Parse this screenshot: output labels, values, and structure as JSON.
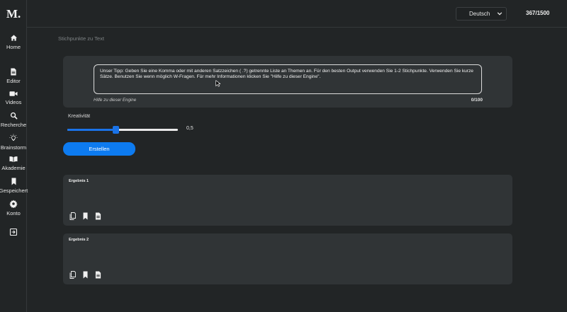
{
  "sidebar": {
    "logo": "M.",
    "items": [
      {
        "label": "Home",
        "icon": "home-icon"
      },
      {
        "label": "Editor",
        "icon": "document-icon"
      },
      {
        "label": "Videos",
        "icon": "video-camera-icon"
      },
      {
        "label": "Recherche",
        "icon": "search-icon"
      },
      {
        "label": "Brainstorm",
        "icon": "lightbulb-icon"
      },
      {
        "label": "Akademie",
        "icon": "book-open-icon"
      },
      {
        "label": "Gespeichert",
        "icon": "bookmark-icon"
      },
      {
        "label": "Konto",
        "icon": "gear-icon"
      }
    ],
    "logout_icon": "logout-icon"
  },
  "header": {
    "language": "Deutsch",
    "word_counter": "367/1500"
  },
  "breadcrumb": "Stichpunkte zu Text",
  "input": {
    "tip": "Unser Tipp: Geben Sie eine Komma oder mit anderen Satzzeichen ( .?) getrennte Liste an Themen an. Für den besten Output verwenden Sie 1-2 Stichpunkte. Verwenden Sie kurze Sätze. Benutzen Sie wenn möglich W-Fragen. Für mehr Informationen klicken Sie \"Hilfe zu dieser Engine\".",
    "help_link": "Hilfe zu dieser Engine",
    "char_count": "0/100"
  },
  "creativity": {
    "label": "Kreativität",
    "value": 0.44,
    "display_value": "0,5"
  },
  "create_button": "Erstellen",
  "results": [
    {
      "title": "Ergebnis 1"
    },
    {
      "title": "Ergebnis 2"
    }
  ],
  "result_actions": [
    "copy-icon",
    "bookmark-icon",
    "document-icon"
  ],
  "colors": {
    "background": "#222526",
    "panel": "#303436",
    "accent": "#0d7bf0"
  }
}
